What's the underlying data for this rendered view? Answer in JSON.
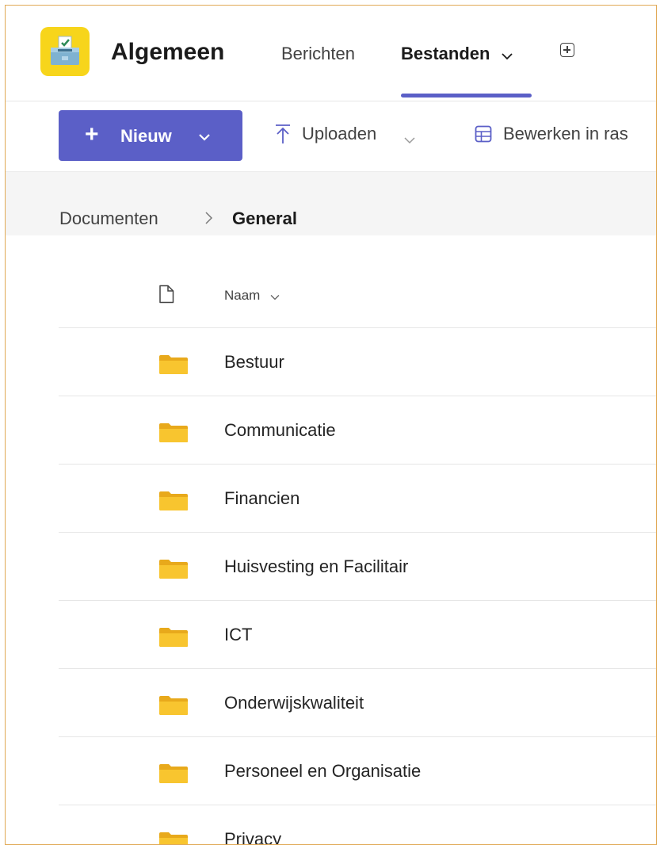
{
  "header": {
    "team_name": "Algemeen",
    "tabs": [
      {
        "label": "Berichten"
      },
      {
        "label": "Bestanden"
      }
    ]
  },
  "toolbar": {
    "new_label": "Nieuw",
    "upload_label": "Uploaden",
    "edit_grid_label": "Bewerken in ras"
  },
  "breadcrumb": {
    "root": "Documenten",
    "current": "General"
  },
  "list": {
    "name_header": "Naam",
    "folders": [
      {
        "name": "Bestuur"
      },
      {
        "name": "Communicatie"
      },
      {
        "name": "Financien"
      },
      {
        "name": "Huisvesting en Facilitair"
      },
      {
        "name": "ICT"
      },
      {
        "name": "Onderwijskwaliteit"
      },
      {
        "name": "Personeel en Organisatie"
      },
      {
        "name": "Privacy"
      }
    ]
  },
  "colors": {
    "accent": "#5b5fc7",
    "team_avatar": "#f7d51b",
    "folder": "#f8c52f",
    "frame_border": "#e0a955"
  }
}
